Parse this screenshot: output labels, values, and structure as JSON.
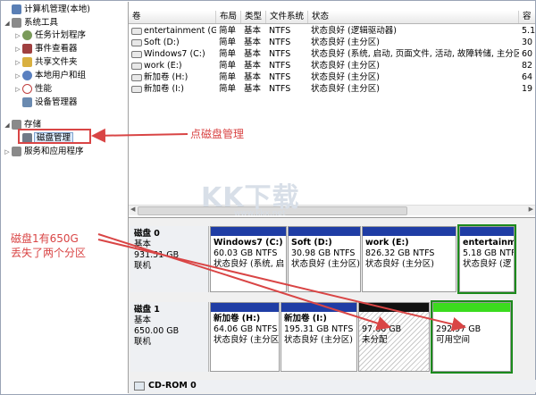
{
  "tree": [
    {
      "label": "计算机管理(本地)",
      "indent": 0,
      "twisty": "",
      "color": "#5a7fb5"
    },
    {
      "label": "系统工具",
      "indent": 1,
      "twisty": "◢",
      "color": "#8a8a8a"
    },
    {
      "label": "任务计划程序",
      "indent": 2,
      "twisty": "▷",
      "color": "#7a9a5a"
    },
    {
      "label": "事件查看器",
      "indent": 2,
      "twisty": "▷",
      "color": "#a04040"
    },
    {
      "label": "共享文件夹",
      "indent": 2,
      "twisty": "▷",
      "color": "#d9b040"
    },
    {
      "label": "本地用户和组",
      "indent": 2,
      "twisty": "▷",
      "color": "#5a80c0"
    },
    {
      "label": "性能",
      "indent": 2,
      "twisty": "▷",
      "color": "#c04040"
    },
    {
      "label": "设备管理器",
      "indent": 2,
      "twisty": "",
      "color": "#6a8ab0"
    },
    {
      "label": "存储",
      "indent": 1,
      "twisty": "◢",
      "color": "#8a8a8a"
    },
    {
      "label": "磁盘管理",
      "indent": 2,
      "twisty": "",
      "color": "#707a88",
      "selected": true
    },
    {
      "label": "服务和应用程序",
      "indent": 1,
      "twisty": "▷",
      "color": "#8a8a8a"
    }
  ],
  "columns": [
    "卷",
    "布局",
    "类型",
    "文件系统",
    "状态",
    "容"
  ],
  "volumes": [
    {
      "name": "entertainment (G:)",
      "layout": "简单",
      "type": "基本",
      "fs": "NTFS",
      "status": "状态良好 (逻辑驱动器)",
      "cap": "5.1"
    },
    {
      "name": "Soft (D:)",
      "layout": "简单",
      "type": "基本",
      "fs": "NTFS",
      "status": "状态良好 (主分区)",
      "cap": "30"
    },
    {
      "name": "Windows7 (C:)",
      "layout": "简单",
      "type": "基本",
      "fs": "NTFS",
      "status": "状态良好 (系统, 启动, 页面文件, 活动, 故障转储, 主分区)",
      "cap": "60"
    },
    {
      "name": "work (E:)",
      "layout": "简单",
      "type": "基本",
      "fs": "NTFS",
      "status": "状态良好 (主分区)",
      "cap": "82"
    },
    {
      "name": "新加卷 (H:)",
      "layout": "简单",
      "type": "基本",
      "fs": "NTFS",
      "status": "状态良好 (主分区)",
      "cap": "64"
    },
    {
      "name": "新加卷 (I:)",
      "layout": "简单",
      "type": "基本",
      "fs": "NTFS",
      "status": "状态良好 (主分区)",
      "cap": "19"
    }
  ],
  "disk0": {
    "name": "磁盘 0",
    "type": "基本",
    "size": "931.51 GB",
    "state": "联机",
    "parts": [
      {
        "name": "Windows7 (C:)",
        "size": "60.03 GB NTFS",
        "status": "状态良好 (系统, 启"
      },
      {
        "name": "Soft (D:)",
        "size": "30.98 GB NTFS",
        "status": "状态良好 (主分区)"
      },
      {
        "name": "work (E:)",
        "size": "826.32 GB NTFS",
        "status": "状态良好 (主分区)"
      },
      {
        "name": "entertainm",
        "size": "5.18 GB NTFS",
        "status": "状态良好 (逻"
      }
    ]
  },
  "disk1": {
    "name": "磁盘 1",
    "type": "基本",
    "size": "650.00 GB",
    "state": "联机",
    "parts": [
      {
        "name": "新加卷 (H:)",
        "size": "64.06 GB NTFS",
        "status": "状态良好 (主分区"
      },
      {
        "name": "新加卷 (I:)",
        "size": "195.31 GB NTFS",
        "status": "状态良好 (主分区)"
      },
      {
        "size": "97.66 GB",
        "status": "未分配"
      },
      {
        "size": "292.97 GB",
        "status": "可用空间"
      }
    ]
  },
  "cdrom": {
    "name": "CD-ROM 0"
  },
  "annotations": {
    "click_disk": "点磁盘管理",
    "note_line1": "磁盘1有650G",
    "note_line2": "丢失了两个分区"
  },
  "watermark": {
    "text": "KK下载",
    "sub": "www.kkx.net"
  },
  "colors": {
    "annotation": "#d94545",
    "partition_bar": "#1f3da5",
    "free_bar": "#3bdc1e",
    "unallocated_bar": "#111111"
  }
}
